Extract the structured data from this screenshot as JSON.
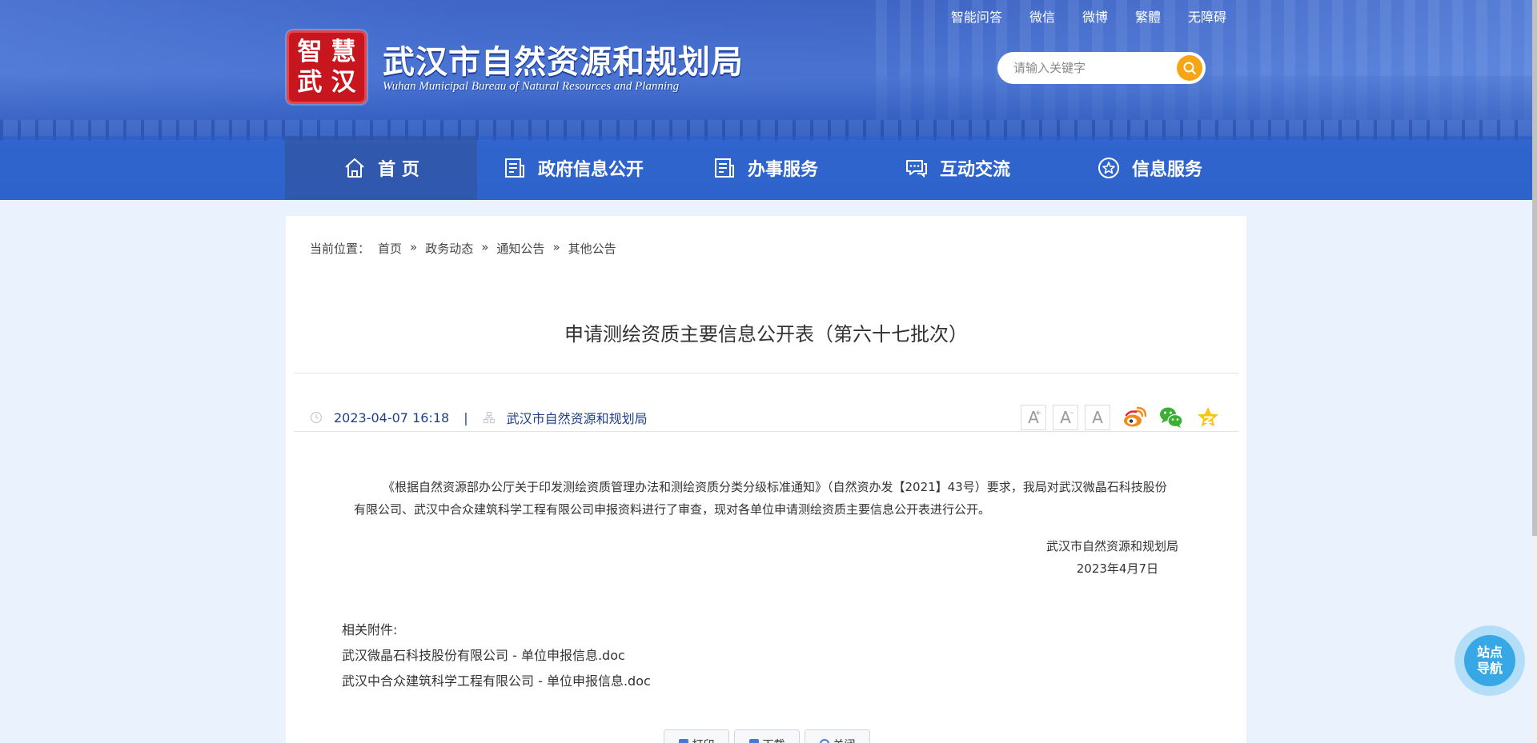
{
  "header": {
    "top_links": [
      "智能问答",
      "微信",
      "微博",
      "繁體",
      "无障碍"
    ],
    "logo_chars": [
      "智",
      "慧",
      "武",
      "汉"
    ],
    "title_cn": "武汉市自然资源和规划局",
    "title_en": "Wuhan Municipal Bureau of Natural Resources and Planning",
    "search_placeholder": "请输入关键字"
  },
  "nav": {
    "items": [
      {
        "label": "首 页",
        "icon": "home-icon"
      },
      {
        "label": "政府信息公开",
        "icon": "document-icon"
      },
      {
        "label": "办事服务",
        "icon": "service-icon"
      },
      {
        "label": "互动交流",
        "icon": "chat-icon"
      },
      {
        "label": "信息服务",
        "icon": "star-icon"
      }
    ]
  },
  "breadcrumb": {
    "prefix": "当前位置：",
    "items": [
      "首页",
      "政务动态",
      "通知公告",
      "其他公告"
    ],
    "separator": "»"
  },
  "article": {
    "title": "申请测绘资质主要信息公开表（第六十七批次）",
    "date": "2023-04-07 16:18",
    "pipe": "|",
    "source": "武汉市自然资源和规划局",
    "font_sizes": [
      "A",
      "A",
      "A"
    ],
    "font_size_marks": [
      "+",
      "-"
    ],
    "paragraph": "《根据自然资源部办公厅关于印发测绘资质管理办法和测绘资质分类分级标准通知》（自然资办发【2021】43号）要求，我局对武汉微晶石科技股份有限公司、武汉中合众建筑科学工程有限公司申报资料进行了审查，现对各单位申请测绘资质主要信息公开表进行公开。",
    "signature": "武汉市自然资源和规划局",
    "sign_date": "2023年4月7日"
  },
  "attachments": {
    "label": "相关附件:",
    "files": [
      "武汉微晶石科技股份有限公司 - 单位申报信息.doc",
      "武汉中合众建筑科学工程有限公司 - 单位申报信息.doc"
    ]
  },
  "actions": [
    "打印",
    "下载",
    "关闭"
  ],
  "site_nav": [
    "站点",
    "导航"
  ],
  "colors": {
    "header_blue": "#3e64c4",
    "meta_text": "#1f3f8a",
    "search_button": "#f6a514",
    "logo_red": "#c7161d",
    "site_nav": "#38a7e6"
  }
}
